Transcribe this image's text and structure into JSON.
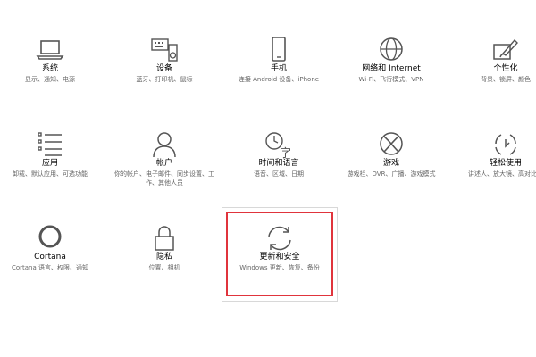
{
  "settings_tiles": [
    {
      "id": "system",
      "title": "系统",
      "desc": "显示、通知、电源",
      "icon": "laptop-icon"
    },
    {
      "id": "devices",
      "title": "设备",
      "desc": "蓝牙、打印机、鼠标",
      "icon": "keyboard-speaker-icon"
    },
    {
      "id": "phone",
      "title": "手机",
      "desc": "连接 Android 设备、iPhone",
      "icon": "phone-icon"
    },
    {
      "id": "network",
      "title": "网络和 Internet",
      "desc": "Wi-Fi、飞行模式、VPN",
      "icon": "globe-icon"
    },
    {
      "id": "personalization",
      "title": "个性化",
      "desc": "背景、锁屏、颜色",
      "icon": "paintbrush-icon"
    },
    {
      "id": "apps",
      "title": "应用",
      "desc": "卸载、默认应用、可选功能",
      "icon": "apps-list-icon"
    },
    {
      "id": "accounts",
      "title": "帐户",
      "desc": "你的帐户、电子邮件、同步设置、工作、其他人员",
      "icon": "person-icon"
    },
    {
      "id": "time-language",
      "title": "时间和语言",
      "desc": "语音、区域、日期",
      "icon": "time-language-icon"
    },
    {
      "id": "gaming",
      "title": "游戏",
      "desc": "游戏栏、DVR、广播、游戏模式",
      "icon": "xbox-icon"
    },
    {
      "id": "ease-of-access",
      "title": "轻松使用",
      "desc": "讲述人、放大镜、高对比度",
      "icon": "ease-of-access-icon"
    },
    {
      "id": "cortana",
      "title": "Cortana",
      "desc": "Cortana 语言、权限、通知",
      "icon": "cortana-icon"
    },
    {
      "id": "privacy",
      "title": "隐私",
      "desc": "位置、相机",
      "icon": "lock-icon"
    },
    {
      "id": "update-security",
      "title": "更新和安全",
      "desc": "Windows 更新、恢复、备份",
      "icon": "sync-icon"
    }
  ],
  "colors": {
    "highlight": "#e0343c",
    "icon": "#555555",
    "desc": "#666666"
  }
}
